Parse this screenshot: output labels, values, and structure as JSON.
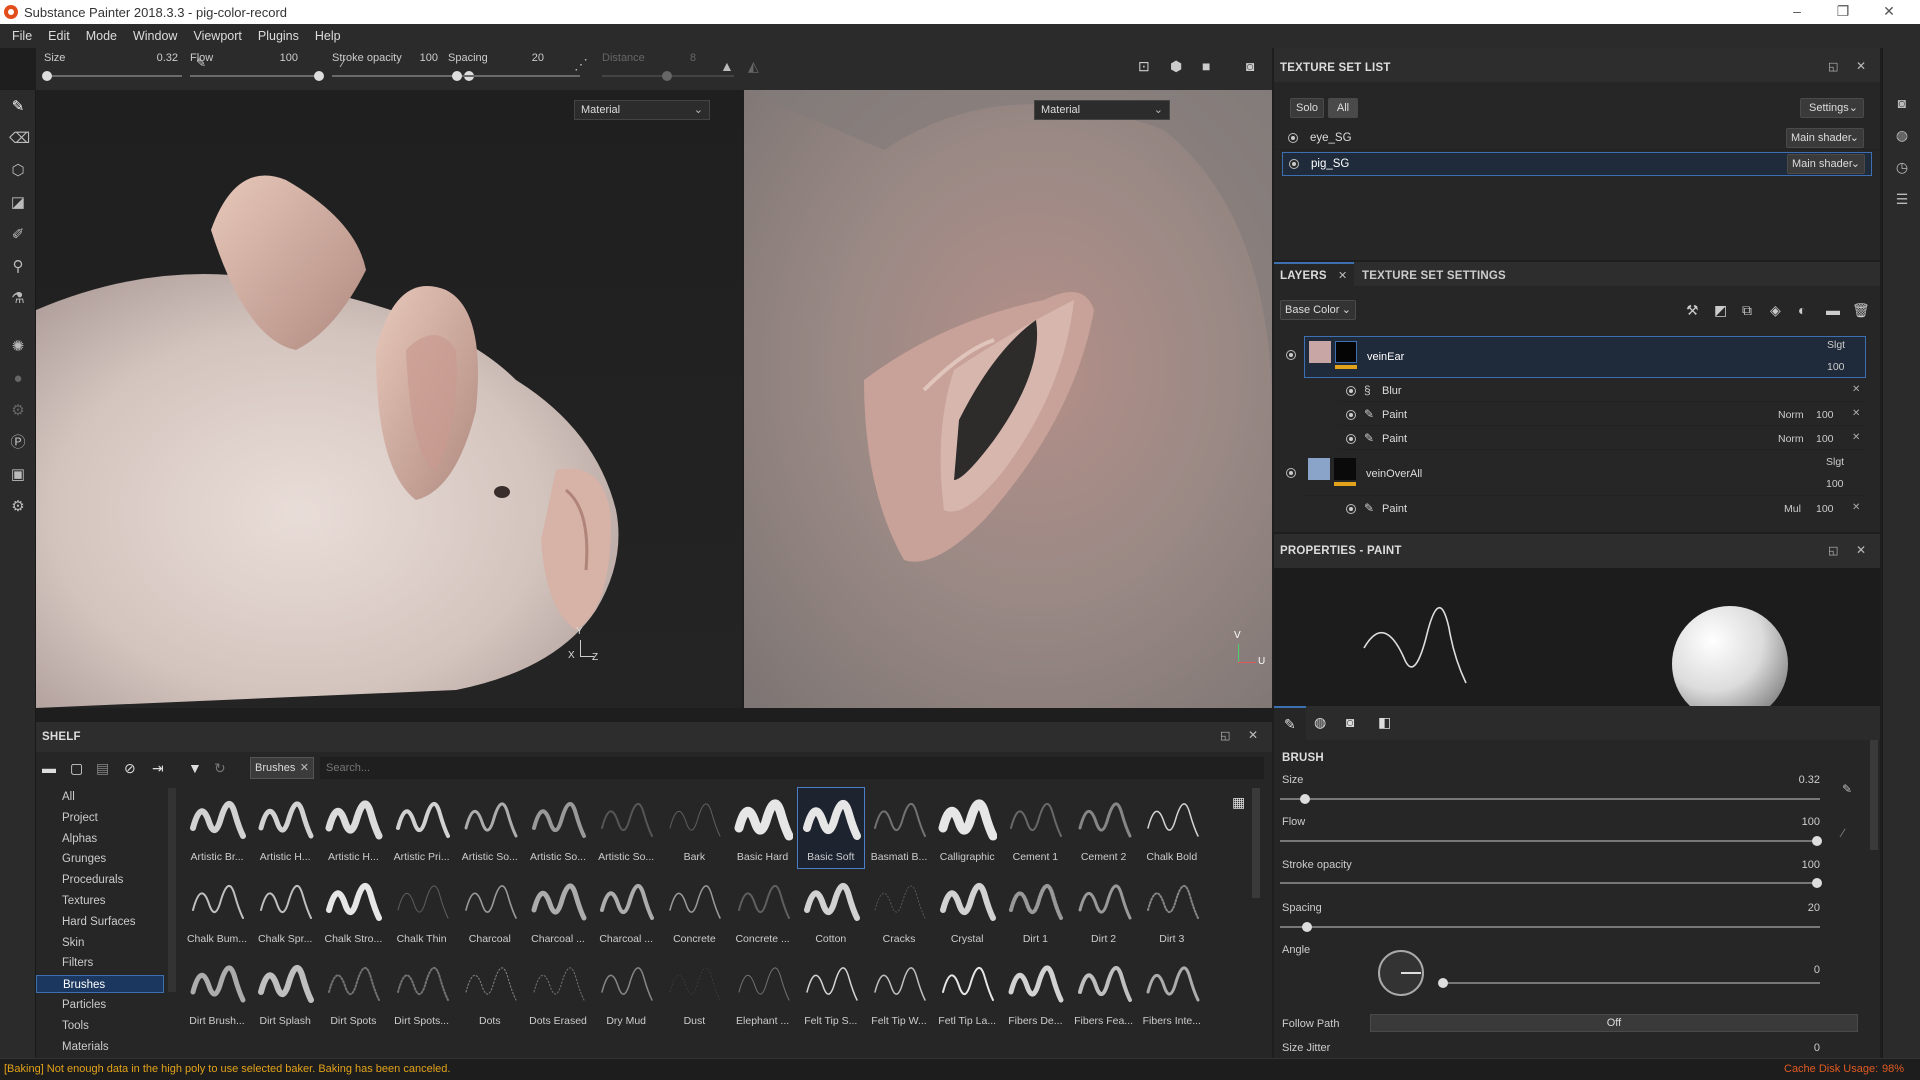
{
  "window": {
    "title": "Substance Painter 2018.3.3 - pig-color-record",
    "minimize": "–",
    "maximize": "❐",
    "close": "✕"
  },
  "menu": [
    "File",
    "Edit",
    "Mode",
    "Window",
    "Viewport",
    "Plugins",
    "Help"
  ],
  "tool_options": {
    "size_label": "Size",
    "size_value": "0.32",
    "flow_label": "Flow",
    "flow_value": "100",
    "stroke_opacity_label": "Stroke opacity",
    "stroke_opacity_value": "100",
    "spacing_label": "Spacing",
    "spacing_value": "20",
    "distance_label": "Distance",
    "distance_value": "8"
  },
  "viewports": {
    "left_mode": "Material",
    "right_mode": "Material",
    "left_axes": {
      "y": "Y",
      "x": "X",
      "z": "Z"
    },
    "right_axes": {
      "v": "V",
      "u": "U"
    }
  },
  "texture_set_list": {
    "title": "TEXTURE SET LIST",
    "solo": "Solo",
    "all": "All",
    "settings": "Settings",
    "sets": [
      {
        "name": "eye_SG",
        "shader": "Main shader"
      },
      {
        "name": "pig_SG",
        "shader": "Main shader"
      }
    ]
  },
  "layers": {
    "tab_layers": "LAYERS",
    "tab_tss": "TEXTURE SET SETTINGS",
    "channel": "Base Color",
    "items": [
      {
        "name": "veinEar",
        "blend": "Slgt",
        "opacity": "100"
      },
      {
        "name": "Blur"
      },
      {
        "name": "Paint",
        "blend": "Norm",
        "opacity": "100"
      },
      {
        "name": "Paint",
        "blend": "Norm",
        "opacity": "100"
      },
      {
        "name": "veinOverAll",
        "blend": "Slgt",
        "opacity": "100"
      },
      {
        "name": "Paint",
        "blend": "Mul",
        "opacity": "100"
      }
    ]
  },
  "properties": {
    "title": "PROPERTIES - PAINT",
    "section": "BRUSH",
    "size_label": "Size",
    "size_value": "0.32",
    "flow_label": "Flow",
    "flow_value": "100",
    "stroke_opacity_label": "Stroke opacity",
    "stroke_opacity_value": "100",
    "spacing_label": "Spacing",
    "spacing_value": "20",
    "angle_label": "Angle",
    "angle_value": "0",
    "follow_path_label": "Follow Path",
    "follow_path_value": "Off",
    "size_jitter_label": "Size Jitter",
    "size_jitter_value": "0"
  },
  "shelf": {
    "title": "SHELF",
    "filter_tag": "Brushes",
    "search_placeholder": "Search...",
    "categories": [
      "All",
      "Project",
      "Alphas",
      "Grunges",
      "Procedurals",
      "Textures",
      "Hard Surfaces",
      "Skin",
      "Filters",
      "Brushes",
      "Particles",
      "Tools",
      "Materials"
    ],
    "selected_category": "Brushes",
    "brushes": [
      "Artistic Br...",
      "Artistic H...",
      "Artistic H...",
      "Artistic Pri...",
      "Artistic So...",
      "Artistic So...",
      "Artistic So...",
      "Bark",
      "Basic Hard",
      "Basic Soft",
      "Basmati B...",
      "Calligraphic",
      "Cement 1",
      "Cement 2",
      "Chalk Bold",
      "Chalk Bum...",
      "Chalk Spr...",
      "Chalk Stro...",
      "Chalk Thin",
      "Charcoal",
      "Charcoal ...",
      "Charcoal ...",
      "Concrete",
      "Concrete ...",
      "Cotton",
      "Cracks",
      "Crystal",
      "Dirt 1",
      "Dirt 2",
      "Dirt 3",
      "Dirt Brush...",
      "Dirt Splash",
      "Dirt Spots",
      "Dirt Spots...",
      "Dots",
      "Dots Erased",
      "Dry Mud",
      "Dust",
      "Elephant ...",
      "Felt Tip S...",
      "Felt Tip W...",
      "Fetl Tip La...",
      "Fibers De...",
      "Fibers Fea...",
      "Fibers Inte..."
    ],
    "selected_brush": "Basic Soft"
  },
  "status": {
    "message": "[Baking] Not enough data in the high poly to use selected baker. Baking has been canceled.",
    "cache_label": "Cache Disk Usage:",
    "cache_value": "98%"
  },
  "colors": {
    "accent": "#3e6fb0",
    "error": "#e2a21a",
    "cache": "#e05a22",
    "panel": "#262626"
  }
}
